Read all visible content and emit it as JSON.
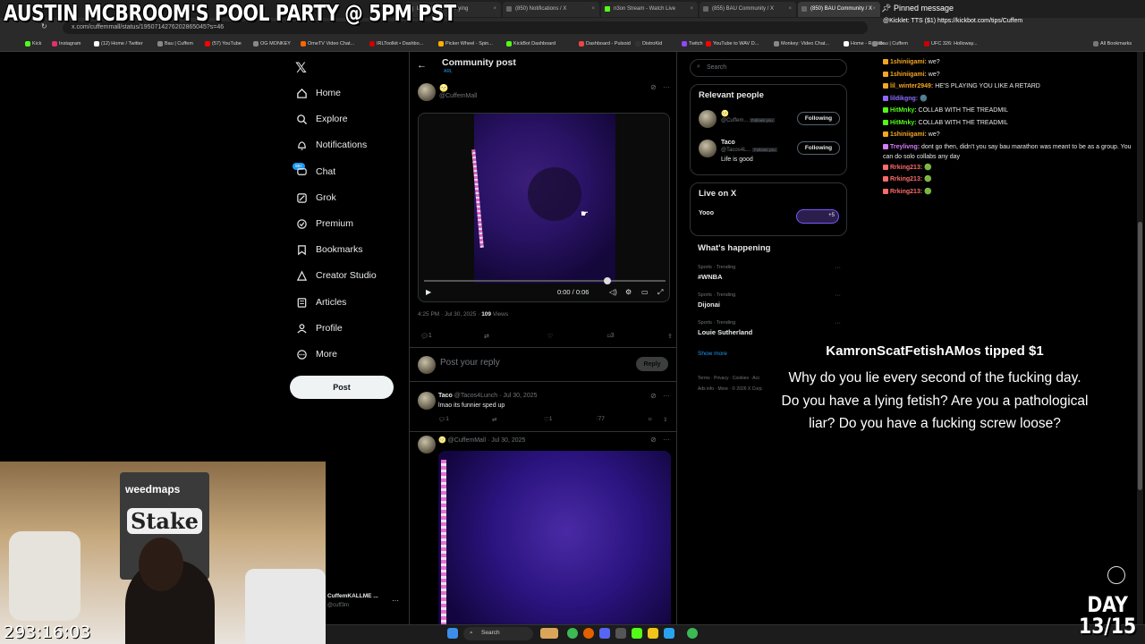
{
  "browser": {
    "tabs": [
      {
        "label": "Lilbz on X: \"I'm crying"
      },
      {
        "label": "(850) Notifications / X"
      },
      {
        "label": "n3on Stream - Watch Live"
      },
      {
        "label": "(855) BAU Community / X"
      },
      {
        "label": "(850) BAU Community / X"
      }
    ],
    "url": "x.com/cuffemmall/status/1950714276202865045?s=46",
    "bookmarks": [
      "Kick",
      "Instagram",
      "(12) Home / Twitter",
      "Bau | Cuffem",
      "(57) YouTube",
      "OG MONKEY",
      "OmeTV Video Chat...",
      "IRLToolkit • Dashbo...",
      "Picker Wheel - Spin...",
      "KickBot Dashboard",
      "Dashboard - Pulsoid",
      "DistroKid",
      "Twitch",
      "YouTube to WAV D...",
      "Monkey: Video Chat...",
      "Home - Roblox",
      "Bau | Cuffem",
      "UFC 326: Holloway..."
    ],
    "all_bookmarks": "All Bookmarks"
  },
  "overlay": {
    "title": "AUSTIN MCBROOM'S POOL PARTY @ 5PM PST",
    "timer": "293:16:03",
    "day_line1": "DAY",
    "day_line2": "13/15"
  },
  "nav": {
    "items": [
      {
        "label": "Home",
        "icon": "home-icon"
      },
      {
        "label": "Explore",
        "icon": "search-icon"
      },
      {
        "label": "Notifications",
        "icon": "bell-icon"
      },
      {
        "label": "Chat",
        "icon": "chat-icon"
      },
      {
        "label": "Grok",
        "icon": "grok-icon"
      },
      {
        "label": "Premium",
        "icon": "premium-icon"
      },
      {
        "label": "Bookmarks",
        "icon": "bookmark-icon"
      },
      {
        "label": "Creator Studio",
        "icon": "creator-studio-icon"
      },
      {
        "label": "Articles",
        "icon": "article-icon"
      },
      {
        "label": "Profile",
        "icon": "person-icon"
      },
      {
        "label": "More",
        "icon": "more-icon"
      }
    ],
    "post_label": "Post",
    "chat_badge": "99+"
  },
  "post": {
    "header_title": "Community post",
    "header_sub": "ARL",
    "author_emoji": "🌝",
    "author_handle": "@CuffemMall",
    "video_time": "0:00 / 0:06",
    "timestamp": "4:25 PM · Jul 30, 2025 · ",
    "views_count": "109",
    "views_label": " Views",
    "replies": "1",
    "bookmarks": "3",
    "reply_placeholder": "Post your reply",
    "reply_button": "Reply"
  },
  "replies": [
    {
      "name": "Taco",
      "handle": "@Tacos4Lunch · Jul 30, 2025",
      "text": "lmao its funnier sped up",
      "replies": "1",
      "likes": "1",
      "views": "77"
    },
    {
      "name": "🌝",
      "handle": "@CuffemMall · Jul 30, 2025",
      "text": ""
    }
  ],
  "sidebar": {
    "search_placeholder": "Search",
    "relevant_title": "Relevant people",
    "people": [
      {
        "name": "🌝",
        "handle": "@Cuffem...",
        "follows": "Follows you",
        "bio": "",
        "button": "Following"
      },
      {
        "name": "Taco",
        "handle": "@Tacos4L...",
        "follows": "Follows you",
        "bio": "Life is good",
        "button": "Following"
      }
    ],
    "live_title": "Live on X",
    "live_text": "Yooo",
    "live_count": "+5",
    "happening_title": "What's happening",
    "trends": [
      {
        "cat": "Sports · Trending",
        "name": "#WNBA"
      },
      {
        "cat": "Sports · Trending",
        "name": "Dijonai"
      },
      {
        "cat": "Sports · Trending",
        "name": "Louie Sutherland"
      }
    ],
    "show_more": "Show more",
    "footer1": "Terms · Privacy · Cookies · Acc",
    "footer2": "Ads info · More · © 2026 X Corp."
  },
  "chat": {
    "pinned_label": "Pinned message",
    "pinned_text": "@Kicklet: TTS ($1) https://kickbot.com/tips/Cuffem",
    "lines": [
      {
        "user": "1shiniigami:",
        "text": "we?",
        "color": "#f5a623"
      },
      {
        "user": "1shiniigami:",
        "text": "we?",
        "color": "#f5a623"
      },
      {
        "user": "lil_winter2949:",
        "text": "HE'S PLAYING YOU LIKE A RETARD",
        "color": "#f5a623"
      },
      {
        "user": "lildikgng:",
        "text": "🌚",
        "color": "#8e6cff"
      },
      {
        "user": "HitMnky:",
        "text": "COLLAB WITH THE TREADMIL",
        "color": "#53fc18"
      },
      {
        "user": "HitMnky:",
        "text": "COLLAB WITH THE TREADMIL",
        "color": "#53fc18"
      },
      {
        "user": "1shiniigami:",
        "text": "we?",
        "color": "#f5a623"
      },
      {
        "user": "Treylivng:",
        "text": "dont go then, didn't you say bau marathon was meant to be as a group. You can do solo collabs any day",
        "color": "#d77bff"
      },
      {
        "user": "Rrking213:",
        "text": "🟢",
        "color": "#ff6b6b"
      },
      {
        "user": "Rrking213:",
        "text": "🟢",
        "color": "#ff6b6b"
      },
      {
        "user": "Rrking213:",
        "text": "🟢",
        "color": "#ff6b6b"
      }
    ]
  },
  "tip": {
    "title": "KamronScatFetishAMos tipped $1",
    "message": "Why do you lie every second of the fucking day. Do you have a lying fetish? Are you a pathological liar? Do you have a fucking screw loose?"
  },
  "webcam": {
    "sponsor1": "weedmaps",
    "sponsor2": "Stake"
  },
  "mini_profile": {
    "name": "CuffemKALLME ...",
    "handle": "@cuff3m"
  },
  "taskbar": {
    "search_label": "Search"
  }
}
